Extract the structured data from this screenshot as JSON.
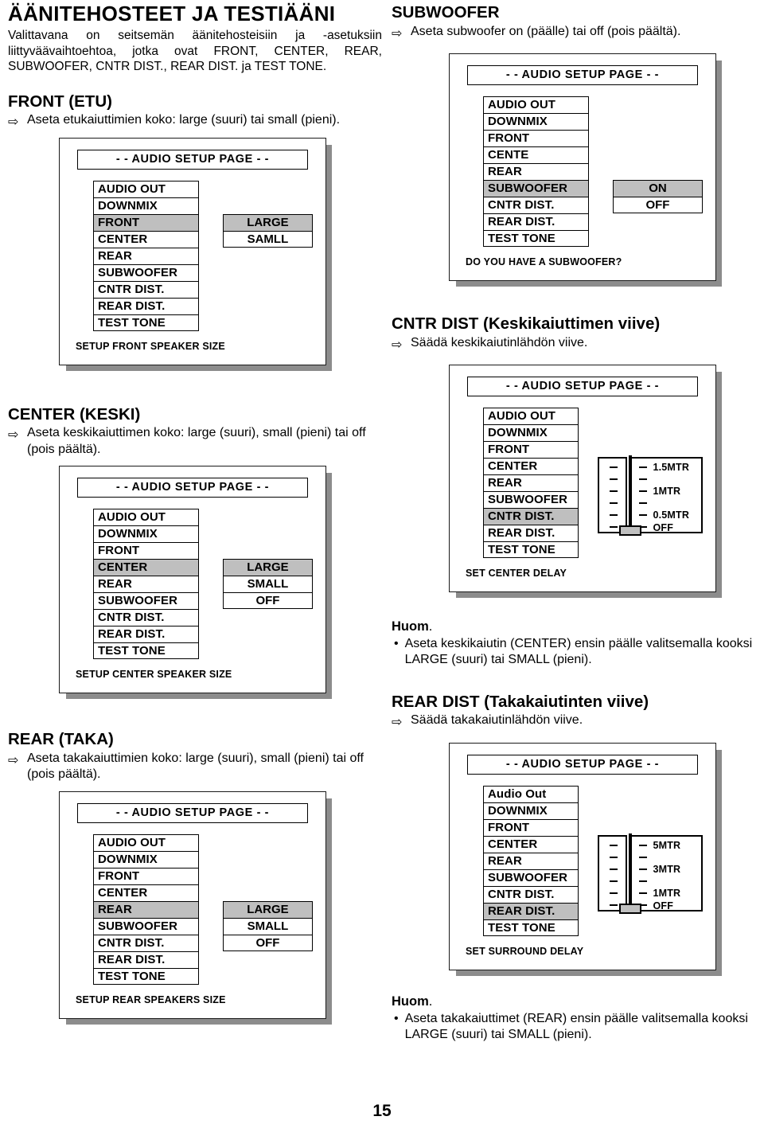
{
  "page_number": "15",
  "icons": {
    "arrow": "⇨",
    "bullet": "•"
  },
  "colors": {
    "highlight": "#bfbfbf",
    "shadow": "#8c8c8c",
    "border": "#000000"
  },
  "menu_items": [
    "AUDIO OUT",
    "DOWNMIX",
    "FRONT",
    "CENTER",
    "REAR",
    "SUBWOOFER",
    "CNTR DIST.",
    "REAR DIST.",
    "TEST TONE"
  ],
  "osd_header": "- - AUDIO SETUP PAGE - -",
  "left": {
    "title": "ÄÄNITEHOSTEET JA TESTIÄÄNI",
    "intro": "Valittavana on seitsemän äänitehosteisiin ja -asetuksiin liittyväävaihtoehtoa, jotka ovat FRONT, CENTER, REAR, SUBWOOFER, CNTR DIST., REAR DIST. ja TEST TONE.",
    "front": {
      "heading": "FRONT (ETU)",
      "instruction": "Aseta etukaiuttimien koko: large (suuri) tai small (pieni).",
      "osd": {
        "header": "- - AUDIO SETUP PAGE - -",
        "items": [
          "AUDIO OUT",
          "DOWNMIX",
          "FRONT",
          "CENTER",
          "REAR",
          "SUBWOOFER",
          "CNTR DIST.",
          "REAR DIST.",
          "TEST TONE"
        ],
        "selected_index": 2,
        "options": [
          "LARGE",
          "SAMLL"
        ],
        "selected_option": 0,
        "caption": "SETUP FRONT SPEAKER SIZE"
      }
    },
    "center": {
      "heading": "CENTER (KESKI)",
      "instruction": "Aseta keskikaiuttimen koko: large (suuri), small (pieni) tai off (pois päältä).",
      "osd": {
        "header": "- - AUDIO SETUP PAGE - -",
        "items": [
          "AUDIO OUT",
          "DOWNMIX",
          "FRONT",
          "CENTER",
          "REAR",
          "SUBWOOFER",
          "CNTR DIST.",
          "REAR DIST.",
          "TEST TONE"
        ],
        "selected_index": 3,
        "options": [
          "LARGE",
          "SMALL",
          "OFF"
        ],
        "selected_option": 0,
        "caption": "SETUP CENTER SPEAKER SIZE"
      }
    },
    "rear": {
      "heading": "REAR (TAKA)",
      "instruction": "Aseta takakaiuttimien koko: large (suuri), small (pieni) tai off (pois päältä).",
      "osd": {
        "header": "- - AUDIO SETUP PAGE - -",
        "items": [
          "AUDIO OUT",
          "DOWNMIX",
          "FRONT",
          "CENTER",
          "REAR",
          "SUBWOOFER",
          "CNTR DIST.",
          "REAR DIST.",
          "TEST TONE"
        ],
        "selected_index": 4,
        "options": [
          "LARGE",
          "SMALL",
          "OFF"
        ],
        "selected_option": 0,
        "caption": "SETUP REAR SPEAKERS SIZE"
      }
    }
  },
  "right": {
    "subwoofer": {
      "heading": "SUBWOOFER",
      "instruction": "Aseta subwoofer on (päälle) tai off (pois päältä).",
      "osd": {
        "header": "- - AUDIO SETUP PAGE - -",
        "items": [
          "AUDIO OUT",
          "DOWNMIX",
          "FRONT",
          "CENTE",
          "REAR",
          "SUBWOOFER",
          "CNTR DIST.",
          "REAR DIST.",
          "TEST TONE"
        ],
        "selected_index": 5,
        "options": [
          "ON",
          "OFF"
        ],
        "selected_option": 0,
        "caption": "DO YOU HAVE A SUBWOOFER?"
      }
    },
    "cntr_dist": {
      "heading": "CNTR DIST (Keskikaiuttimen viive)",
      "instruction": "Säädä keskikaiutinlähdön viive.",
      "osd": {
        "header": "- - AUDIO SETUP PAGE - -",
        "items": [
          "AUDIO OUT",
          "DOWNMIX",
          "FRONT",
          "CENTER",
          "REAR",
          "SUBWOOFER",
          "CNTR DIST.",
          "REAR DIST.",
          "TEST TONE"
        ],
        "selected_index": 6,
        "slider": {
          "labels": [
            "1.5MTR",
            "1MTR",
            "0.5MTR",
            "OFF"
          ],
          "tick_count": 6,
          "thumb_position": "bottom"
        },
        "caption": "SET CENTER DELAY"
      },
      "note": {
        "title": "Huom",
        "title_dot": ".",
        "bullet": "Aseta keskikaiutin (CENTER) ensin päälle valitsemalla kooksi LARGE (suuri) tai SMALL (pieni)."
      }
    },
    "rear_dist": {
      "heading": "REAR DIST (Takakaiutinten viive)",
      "instruction": "Säädä takakaiutinlähdön viive.",
      "osd": {
        "header": "- - AUDIO SETUP PAGE - -",
        "items": [
          "Audio Out",
          "DOWNMIX",
          "FRONT",
          "CENTER",
          "REAR",
          "SUBWOOFER",
          "CNTR DIST.",
          "REAR DIST.",
          "TEST TONE"
        ],
        "selected_index": 7,
        "slider": {
          "labels": [
            "5MTR",
            "3MTR",
            "1MTR",
            "OFF"
          ],
          "tick_count": 6,
          "thumb_position": "bottom"
        },
        "caption": "SET SURROUND DELAY"
      },
      "note": {
        "title": "Huom",
        "title_dot": ".",
        "bullet": "Aseta takakaiuttimet (REAR) ensin päälle valitsemalla kooksi LARGE (suuri) tai SMALL (pieni)."
      }
    }
  }
}
